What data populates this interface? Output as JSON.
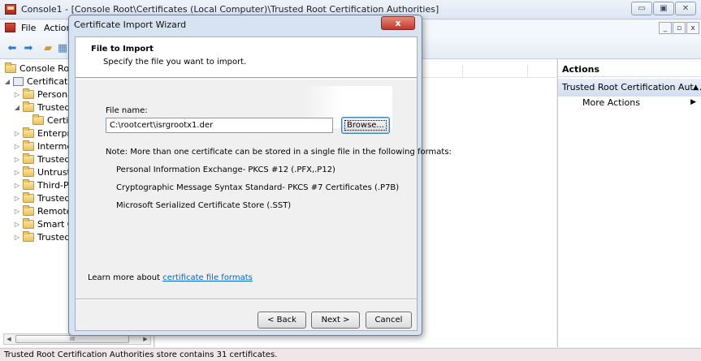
{
  "mmc": {
    "title": "Console1 - [Console Root\\Certificates (Local Computer)\\Trusted Root Certification Authorities]",
    "menu": {
      "file": "File",
      "action": "Action"
    },
    "window_buttons": {
      "minimize": "▭",
      "maximize": "▣",
      "close": "✕"
    },
    "mdi_buttons": {
      "minimize": "_",
      "restore": "▫",
      "close": "x"
    }
  },
  "tree": {
    "items": [
      {
        "label": "Console Root",
        "expander": ""
      },
      {
        "label": "Certificates (Local Computer)",
        "expander": "◢"
      },
      {
        "label": "Personal",
        "expander": "▷"
      },
      {
        "label": "Trusted Root Certification Authorities",
        "expander": "◢"
      },
      {
        "label": "Certificates",
        "expander": ""
      },
      {
        "label": "Enterprise Trust",
        "expander": "▷"
      },
      {
        "label": "Intermediate Certification Authorities",
        "expander": "▷"
      },
      {
        "label": "Trusted Publishers",
        "expander": "▷"
      },
      {
        "label": "Untrusted Certificates",
        "expander": "▷"
      },
      {
        "label": "Third-Party Root Certification Authorities",
        "expander": "▷"
      },
      {
        "label": "Trusted People",
        "expander": "▷"
      },
      {
        "label": "Remote Desktop",
        "expander": "▷"
      },
      {
        "label": "Smart Card Trusted Roots",
        "expander": "▷"
      },
      {
        "label": "Trusted Devices",
        "expander": "▷"
      }
    ],
    "scroll_thumb": "III",
    "scroll_left": "◀",
    "scroll_right": "▶"
  },
  "actions": {
    "header": "Actions",
    "section": "Trusted Root Certification Aut...",
    "section_arrow": "▲",
    "more": "More Actions",
    "more_arrow": "▶"
  },
  "status": "Trusted Root Certification Authorities store contains 31 certificates.",
  "wizard": {
    "title": "Certificate Import Wizard",
    "close": "x",
    "heading": "File to Import",
    "subheading": "Specify the file you want to import.",
    "file_label": "File name:",
    "file_value": "C:\\rootcert\\isrgrootx1.der",
    "browse": "Browse...",
    "note": "Note:  More than one certificate can be stored in a single file in the following formats:",
    "formats": [
      "Personal Information Exchange- PKCS #12 (.PFX,.P12)",
      "Cryptographic Message Syntax Standard- PKCS #7 Certificates (.P7B)",
      "Microsoft Serialized Certificate Store (.SST)"
    ],
    "learn_prefix": "Learn more about ",
    "learn_link": "certificate file formats",
    "back": "< Back",
    "next": "Next >",
    "cancel": "Cancel"
  }
}
